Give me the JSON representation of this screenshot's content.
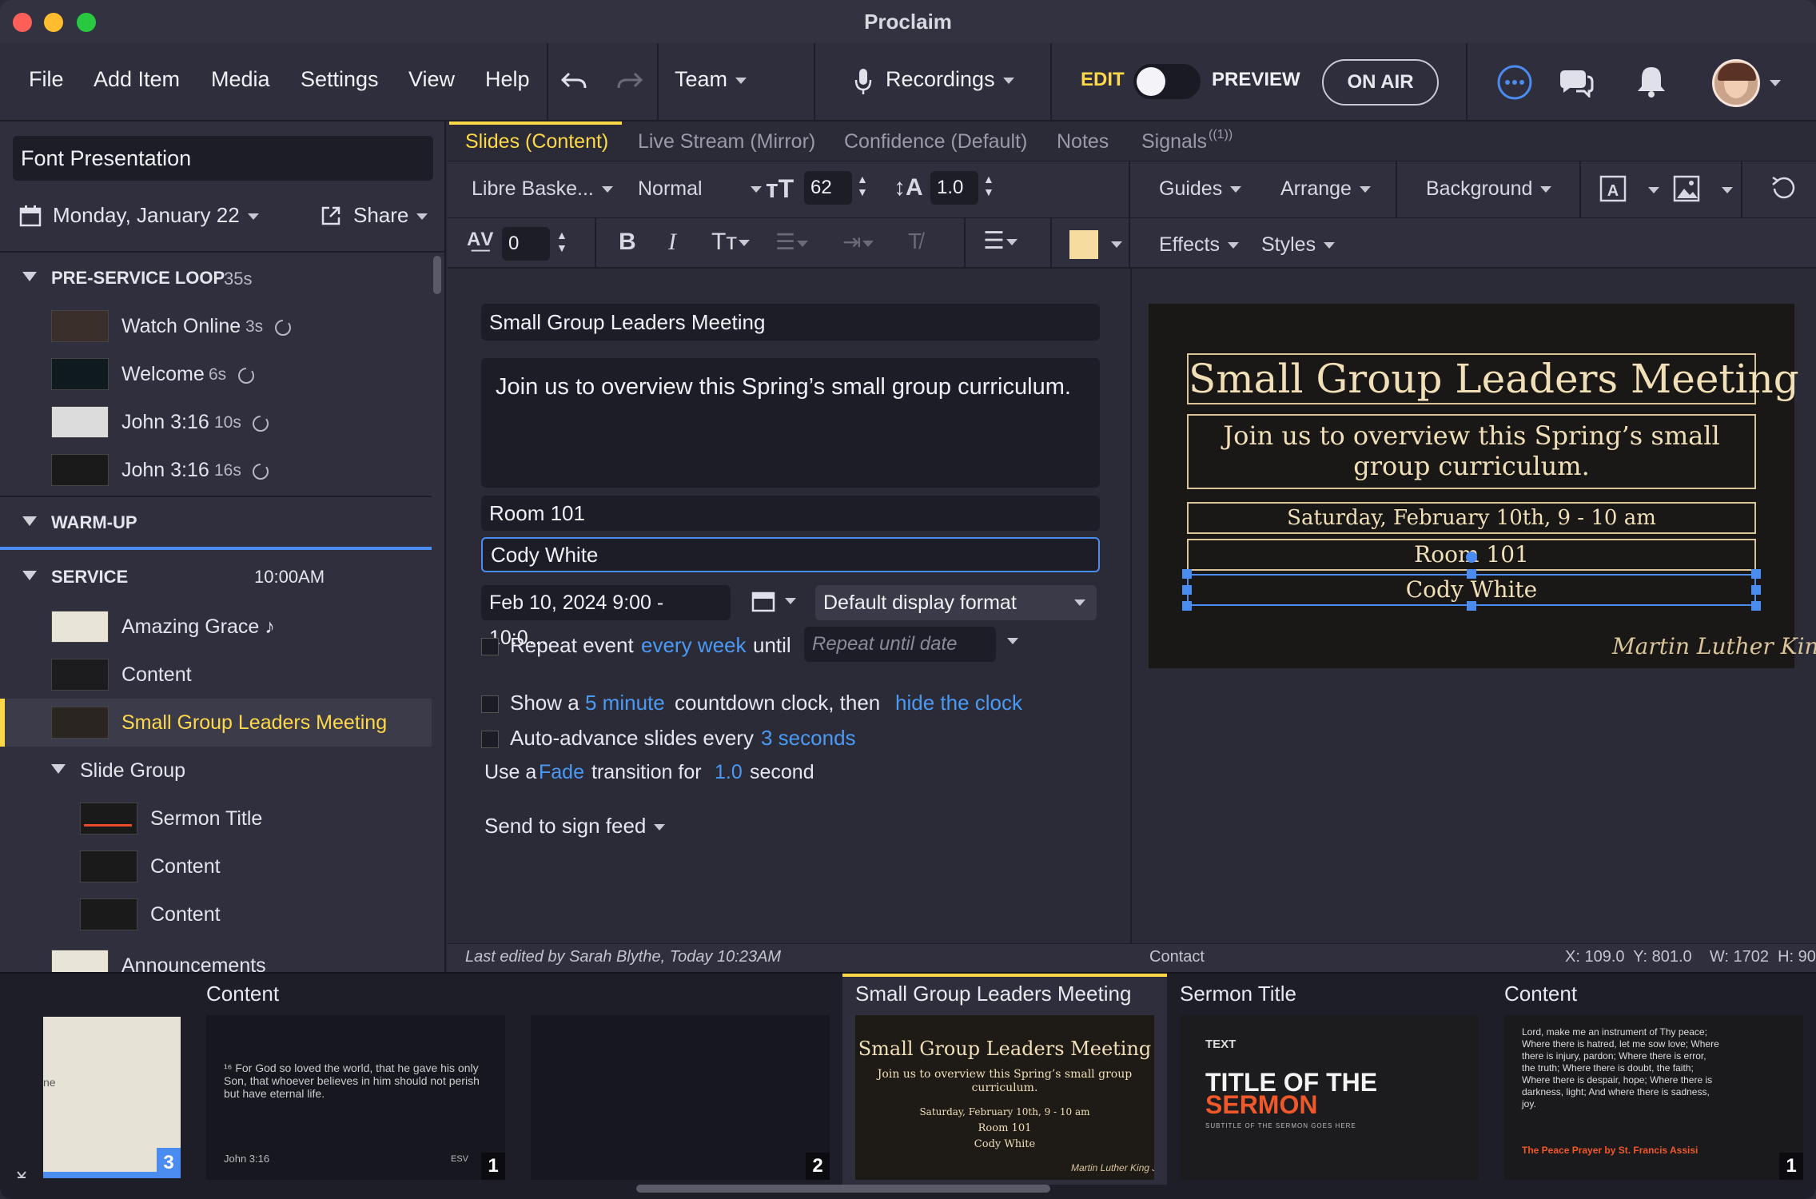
{
  "app": {
    "title": "Proclaim"
  },
  "menu": {
    "file": "File",
    "add_item": "Add Item",
    "media": "Media",
    "settings": "Settings",
    "view": "View",
    "help": "Help",
    "team": "Team",
    "recordings": "Recordings",
    "edit": "EDIT",
    "preview": "PREVIEW",
    "on_air": "ON AIR"
  },
  "sidebar": {
    "presentation_name": "Font Presentation",
    "date": "Monday, January 22",
    "share": "Share",
    "sections": [
      {
        "label": "PRE-SERVICE LOOP",
        "duration": "35s"
      },
      {
        "label": "WARM-UP"
      },
      {
        "label": "SERVICE",
        "time": "10:00AM"
      }
    ],
    "loop_items": [
      {
        "label": "Watch Online",
        "duration": "3s"
      },
      {
        "label": "Welcome",
        "duration": "6s"
      },
      {
        "label": "John 3:16",
        "duration": "10s"
      },
      {
        "label": "John 3:16",
        "duration": "16s"
      }
    ],
    "service_items": [
      {
        "label": "Amazing Grace ♪"
      },
      {
        "label": "Content"
      },
      {
        "label": "Small Group Leaders Meeting"
      }
    ],
    "group": {
      "label": "Slide Group",
      "items": [
        {
          "label": "Sermon Title"
        },
        {
          "label": "Content"
        },
        {
          "label": "Content"
        }
      ]
    },
    "partial_item": "Announcements"
  },
  "tabs": [
    {
      "label": "Slides (Content)"
    },
    {
      "label": "Live Stream (Mirror)"
    },
    {
      "label": "Confidence (Default)"
    },
    {
      "label": "Notes"
    },
    {
      "label": "Signals"
    },
    {
      "label": "((1))"
    }
  ],
  "toolbar": {
    "font": "Libre Baske...",
    "weight": "Normal",
    "size": "62",
    "line_height": "1.0",
    "tracking": "0",
    "guides": "Guides",
    "arrange": "Arrange",
    "background": "Background",
    "effects": "Effects",
    "styles": "Styles",
    "swatch_color": "#f7dca0"
  },
  "form": {
    "title": "Small Group Leaders Meeting",
    "body": "Join us to overview this Spring’s small group curriculum.",
    "room": "Room 101",
    "contact": "Cody White",
    "datetime": "Feb 10, 2024 9:00 - 10:0…",
    "display_format": "Default display format",
    "repeat_prefix": "Repeat event",
    "repeat_every": "every week",
    "repeat_until": "until",
    "repeat_placeholder": "Repeat until date",
    "countdown_a": "Show a",
    "countdown_link": "5 minute",
    "countdown_b": "countdown clock, then",
    "countdown_link2": "hide the clock",
    "advance_a": "Auto-advance slides every",
    "advance_link": "3 seconds",
    "trans_a": "Use a",
    "trans_link": "Fade",
    "trans_b": "transition  for",
    "trans_link2": "1.0",
    "trans_c": "second",
    "sign_feed": "Send to sign feed"
  },
  "slide": {
    "title": "Small Group Leaders Meeting",
    "body": "Join us to overview this Spring’s small group curriculum.",
    "date": "Saturday, February 10th, 9 - 10 am",
    "room": "Room 101",
    "contact": "Cody White",
    "signature": "Martin Luther King Jr."
  },
  "status": {
    "last_edited": "Last edited by Sarah Blythe, Today 10:23AM",
    "field": "Contact",
    "coords": "X: 109.0  Y: 801.0    W: 1702  H: 90"
  },
  "filmstrip": [
    {
      "title": "",
      "badge": "3",
      "text": "ne"
    },
    {
      "title": "Content",
      "badge": "1",
      "verse": "¹⁶ For God so loved the world, that he gave his only Son, that whoever believes in him should not perish but have eternal life.",
      "ref": "John 3:16",
      "version": "ESV"
    },
    {
      "title": "",
      "badge": "2"
    },
    {
      "title": "Small Group Leaders Meeting",
      "badge": ""
    },
    {
      "title": "Sermon Title",
      "small": "TEXT",
      "big1": "TITLE OF THE",
      "big2": "SERMON",
      "sub": "SUBTITLE OF THE SERMON GOES HERE"
    },
    {
      "title": "Content",
      "badge": "1",
      "lines": "Lord, make me an instrument of Thy peace; Where there is hatred, let me sow love; Where there is injury, pardon; Where there is error, the truth; Where there is doubt, the faith; Where there is despair, hope; Where there is darkness, light; And where there is sadness, joy.",
      "credit": "The Peace Prayer by St. Francis Assisi"
    }
  ]
}
